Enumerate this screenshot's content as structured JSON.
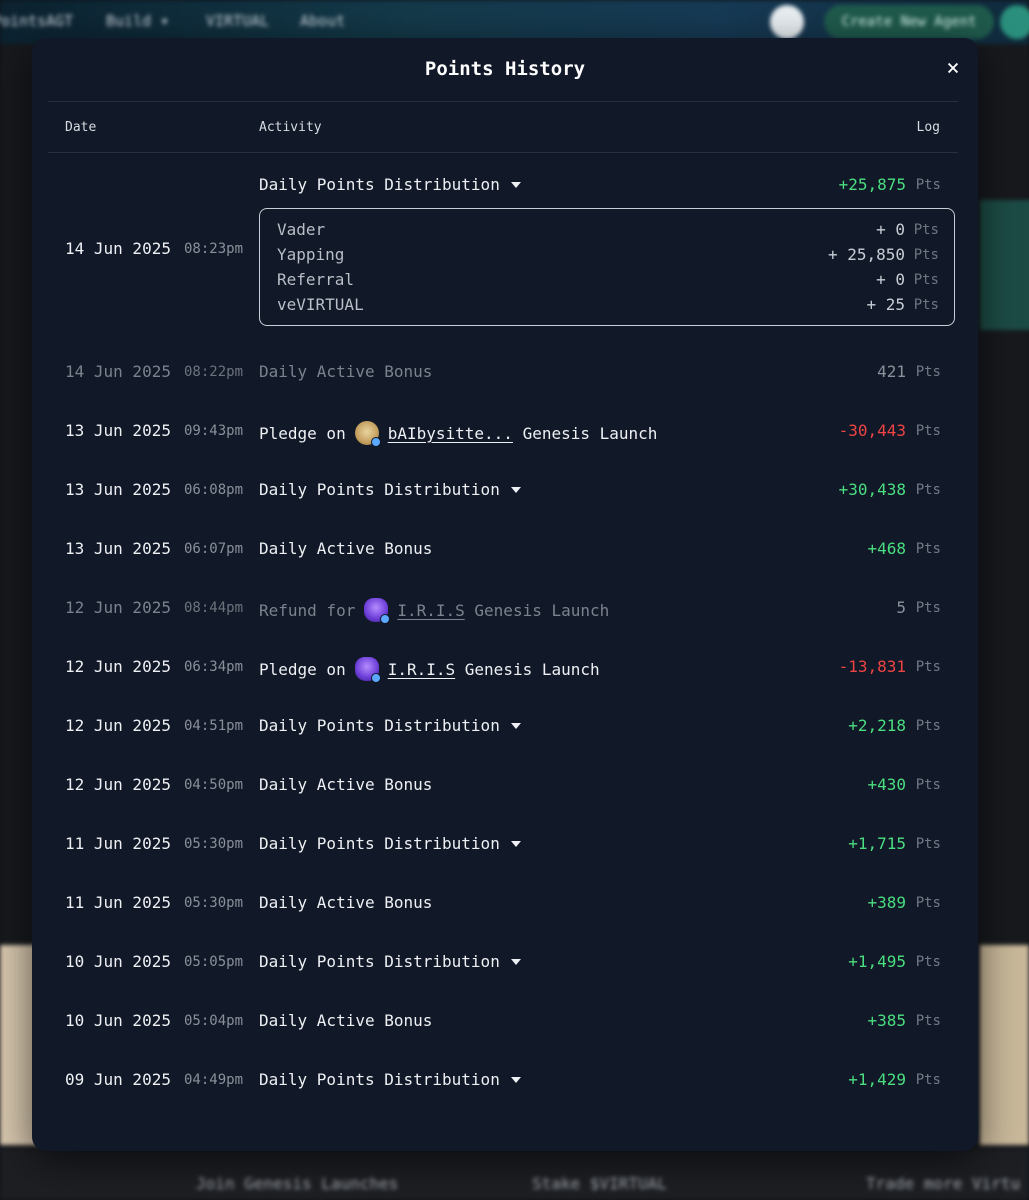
{
  "background": {
    "nav": [
      "Points",
      "AGT",
      "Build ▾",
      "VIRTUAL",
      "About"
    ],
    "create_button": "Create New Agent",
    "footer": [
      "Join Genesis Launches",
      "Stake $VIRTUAL",
      "Trade more Virtu"
    ]
  },
  "modal": {
    "title": "Points History",
    "close_icon": "×",
    "columns": {
      "date": "Date",
      "activity": "Activity",
      "log": "Log"
    },
    "unit": "Pts"
  },
  "rows": [
    {
      "date": "14 Jun 2025",
      "time": "08:23pm",
      "activity": "Daily Points Distribution",
      "amount": "+25,875",
      "tone": "pos",
      "expandable": true
    },
    {
      "date": "14 Jun 2025",
      "time": "08:22pm",
      "activity": "Daily Active Bonus",
      "amount": "421",
      "tone": "neutral",
      "dim": true
    },
    {
      "date": "13 Jun 2025",
      "time": "09:43pm",
      "prefix": "Pledge on",
      "token": "bAIbysitte...",
      "suffix": "Genesis Launch",
      "amount": "-30,443",
      "tone": "neg",
      "icon": "baby"
    },
    {
      "date": "13 Jun 2025",
      "time": "06:08pm",
      "activity": "Daily Points Distribution",
      "amount": "+30,438",
      "tone": "pos",
      "expandable": true
    },
    {
      "date": "13 Jun 2025",
      "time": "06:07pm",
      "activity": "Daily Active Bonus",
      "amount": "+468",
      "tone": "pos"
    },
    {
      "date": "12 Jun 2025",
      "time": "08:44pm",
      "prefix": "Refund for",
      "token": "I.R.I.S",
      "suffix": "Genesis Launch",
      "amount": "5",
      "tone": "neutral",
      "icon": "iris",
      "dim": true
    },
    {
      "date": "12 Jun 2025",
      "time": "06:34pm",
      "prefix": "Pledge on",
      "token": "I.R.I.S",
      "suffix": "Genesis Launch",
      "amount": "-13,831",
      "tone": "neg",
      "icon": "iris"
    },
    {
      "date": "12 Jun 2025",
      "time": "04:51pm",
      "activity": "Daily Points Distribution",
      "amount": "+2,218",
      "tone": "pos",
      "expandable": true
    },
    {
      "date": "12 Jun 2025",
      "time": "04:50pm",
      "activity": "Daily Active Bonus",
      "amount": "+430",
      "tone": "pos"
    },
    {
      "date": "11 Jun 2025",
      "time": "05:30pm",
      "activity": "Daily Points Distribution",
      "amount": "+1,715",
      "tone": "pos",
      "expandable": true
    },
    {
      "date": "11 Jun 2025",
      "time": "05:30pm",
      "activity": "Daily Active Bonus",
      "amount": "+389",
      "tone": "pos"
    },
    {
      "date": "10 Jun 2025",
      "time": "05:05pm",
      "activity": "Daily Points Distribution",
      "amount": "+1,495",
      "tone": "pos",
      "expandable": true
    },
    {
      "date": "10 Jun 2025",
      "time": "05:04pm",
      "activity": "Daily Active Bonus",
      "amount": "+385",
      "tone": "pos"
    },
    {
      "date": "09 Jun 2025",
      "time": "04:49pm",
      "activity": "Daily Points Distribution",
      "amount": "+1,429",
      "tone": "pos",
      "expandable": true
    }
  ],
  "breakdown": [
    {
      "label": "Vader",
      "value": "+ 0"
    },
    {
      "label": "Yapping",
      "value": "+ 25,850"
    },
    {
      "label": "Referral",
      "value": "+ 0"
    },
    {
      "label": "veVIRTUAL",
      "value": "+ 25"
    }
  ]
}
